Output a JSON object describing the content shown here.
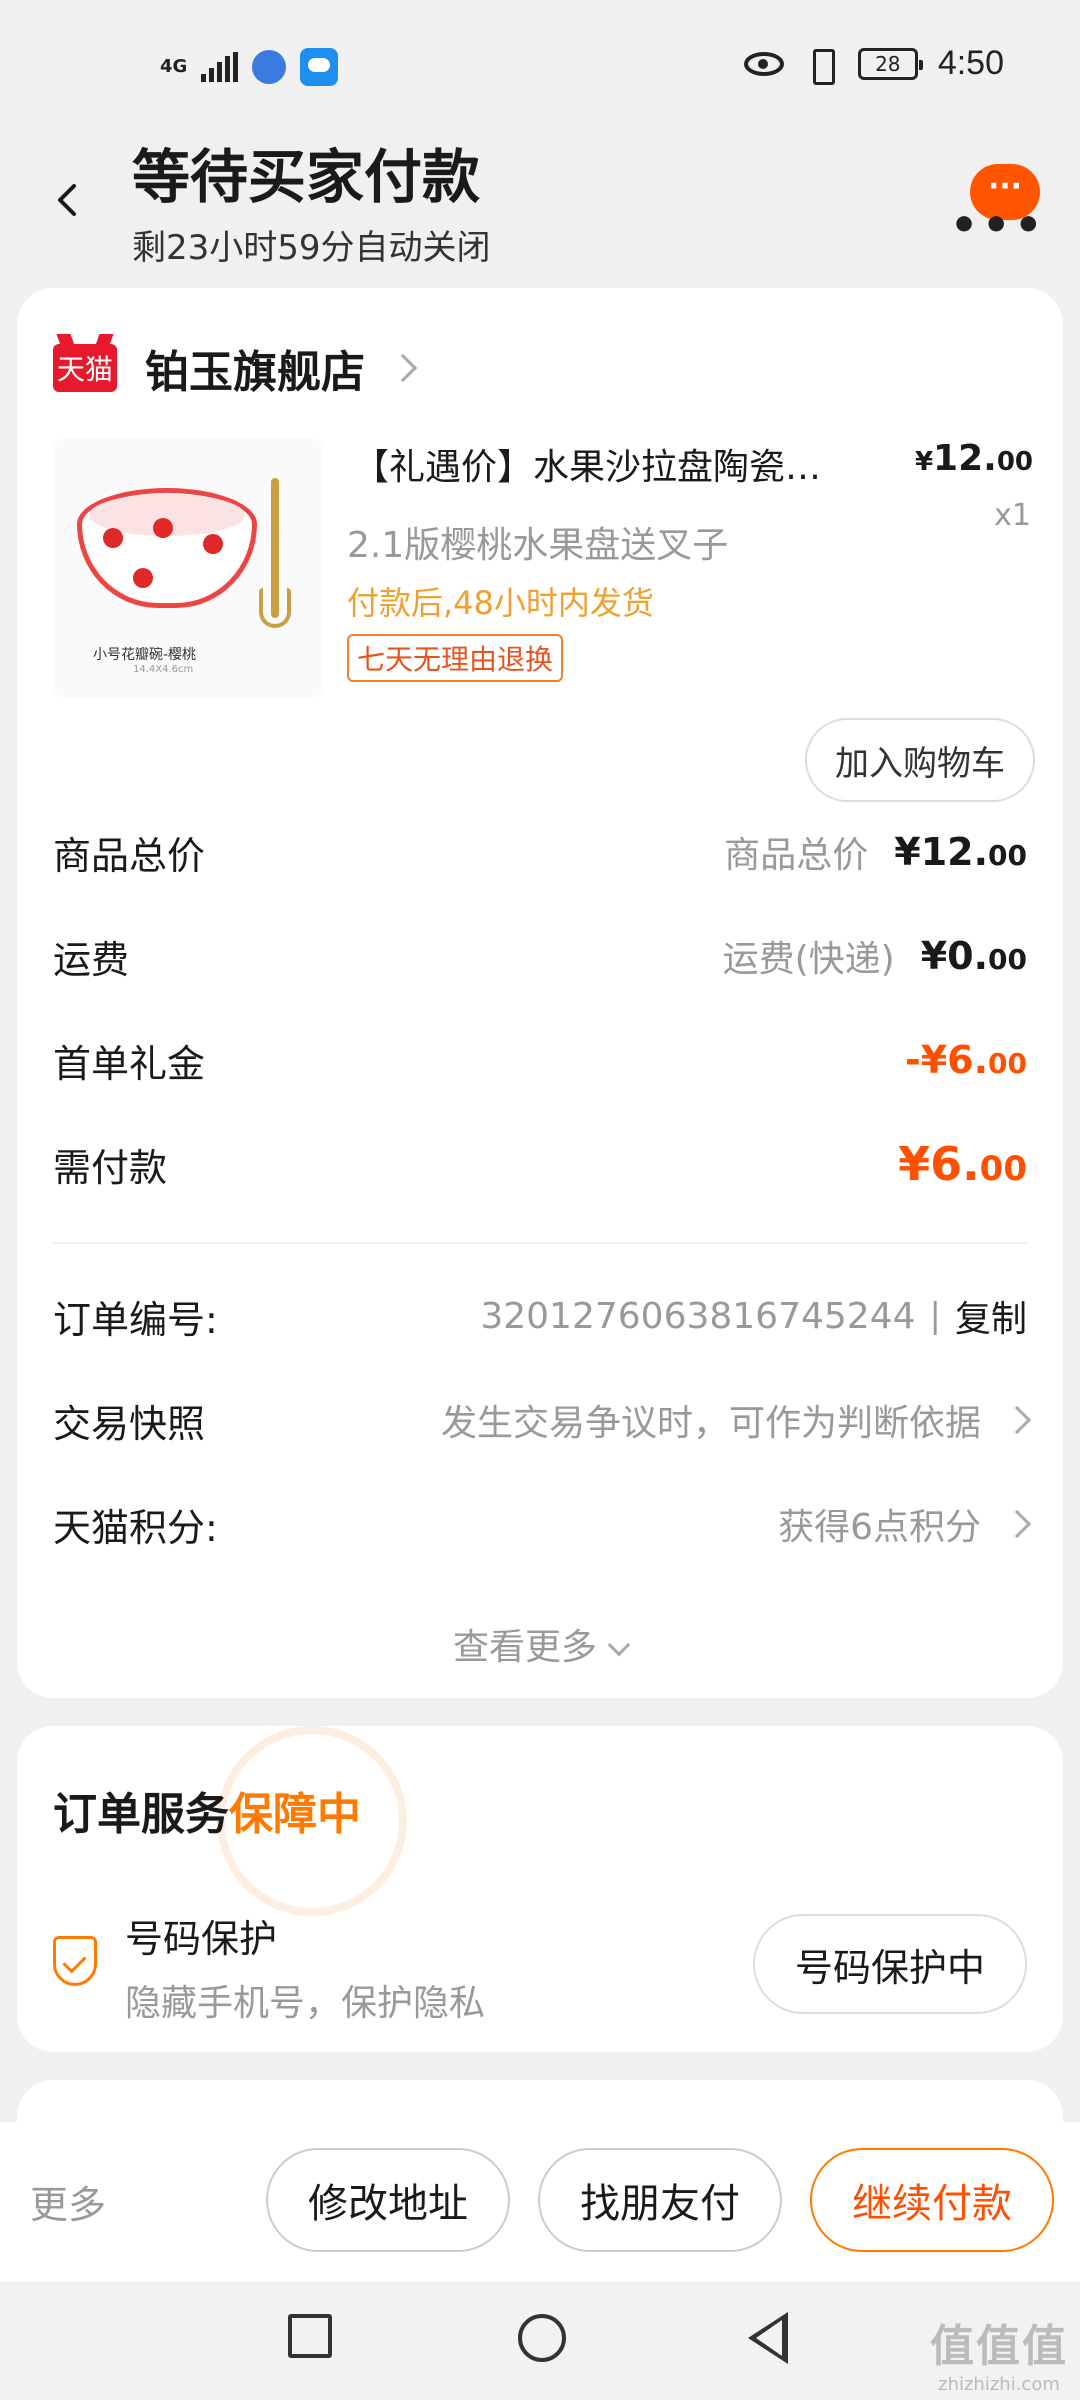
{
  "status_bar": {
    "network": "4G",
    "battery": "28",
    "time": "4:50"
  },
  "header": {
    "title": "等待买家付款",
    "subtitle": "剩23小时59分自动关闭",
    "more_bubble": "···",
    "more_dots": "•••"
  },
  "store": {
    "logo_text": "天猫",
    "name": "铂玉旗舰店"
  },
  "product": {
    "title": "【礼遇价】水果沙拉盘陶瓷…",
    "spec": "2.1版樱桃水果盘送叉子",
    "shipping": "付款后,48小时内发货",
    "tag": "七天无理由退换",
    "price_symbol": "¥",
    "price_int": "12.",
    "price_dec": "00",
    "qty": "x1",
    "image_caption": "小号花瓣碗-樱桃",
    "image_size": "14.4X4.6cm",
    "add_to_cart": "加入购物车"
  },
  "summary": {
    "goods_total_label": "商品总价",
    "goods_total_hint": "商品总价",
    "goods_total_int": "¥12.",
    "goods_total_dec": "00",
    "shipping_label": "运费",
    "shipping_hint": "运费(快递)",
    "shipping_int": "¥0.",
    "shipping_dec": "00",
    "gift_label": "首单礼金",
    "gift_int": "-¥6.",
    "gift_dec": "00",
    "payable_label": "需付款",
    "payable_int": "¥6.",
    "payable_dec": "00"
  },
  "order_info": {
    "order_no_label": "订单编号:",
    "order_no": "3201276063816745244",
    "separator": "|",
    "copy": "复制",
    "snapshot_label": "交易快照",
    "snapshot_value": "发生交易争议时，可作为判断依据",
    "points_label": "天猫积分:",
    "points_value": "获得6点积分",
    "see_more": "查看更多"
  },
  "service": {
    "title_main": "订单服务",
    "title_highlight": "保障中",
    "item_name": "号码保护",
    "item_desc": "隐藏手机号，保护隐私",
    "item_button": "号码保护中"
  },
  "bottom_bar": {
    "more": "更多",
    "modify_address": "修改地址",
    "friend_pay": "找朋友付",
    "continue_pay": "继续付款"
  },
  "watermark": {
    "logo": "值值值",
    "url": "zhizhizhi.com"
  },
  "colors": {
    "accent": "#ff5000",
    "highlight": "#ff7a00",
    "tmall_red": "#e8192c",
    "shipping_yellow": "#f0a030"
  }
}
